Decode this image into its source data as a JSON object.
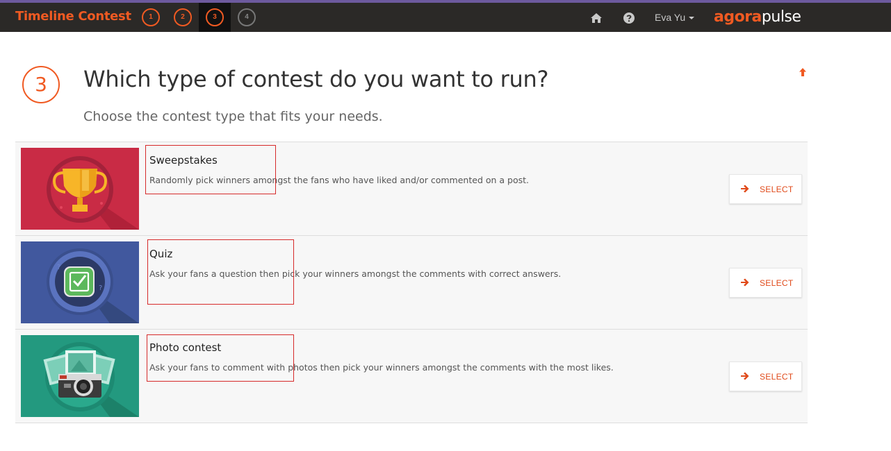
{
  "app": {
    "title": "Timeline Contest",
    "steps": [
      "1",
      "2",
      "3",
      "4"
    ],
    "active_step": "3"
  },
  "nav": {
    "home_icon": "home-icon",
    "help_icon": "question-circle-icon",
    "user_name": "Eva Yu",
    "brand_part1": "agora",
    "brand_part2": "pulse"
  },
  "header": {
    "step_number": "3",
    "title": "Which type of contest do you want to run?",
    "subtitle": "Choose the contest type that fits your needs."
  },
  "contest_types": [
    {
      "title": "Sweepstakes",
      "description": "Randomly pick winners amongst the fans who have liked and/or commented on a post.",
      "icon": "trophy-icon",
      "select_label": "SELECT"
    },
    {
      "title": "Quiz",
      "description": "Ask your fans a question then pick your winners amongst the comments with correct answers.",
      "icon": "checkmark-icon",
      "select_label": "SELECT"
    },
    {
      "title": "Photo contest",
      "description": "Ask your fans to comment with photos then pick your winners amongst the comments with the most likes.",
      "icon": "camera-icon",
      "select_label": "SELECT"
    }
  ],
  "colors": {
    "accent": "#f05a22",
    "topbar": "#2b2927",
    "sweepstakes_bg": "#c92b45",
    "quiz_bg": "#41589e",
    "photo_bg": "#23997f"
  }
}
